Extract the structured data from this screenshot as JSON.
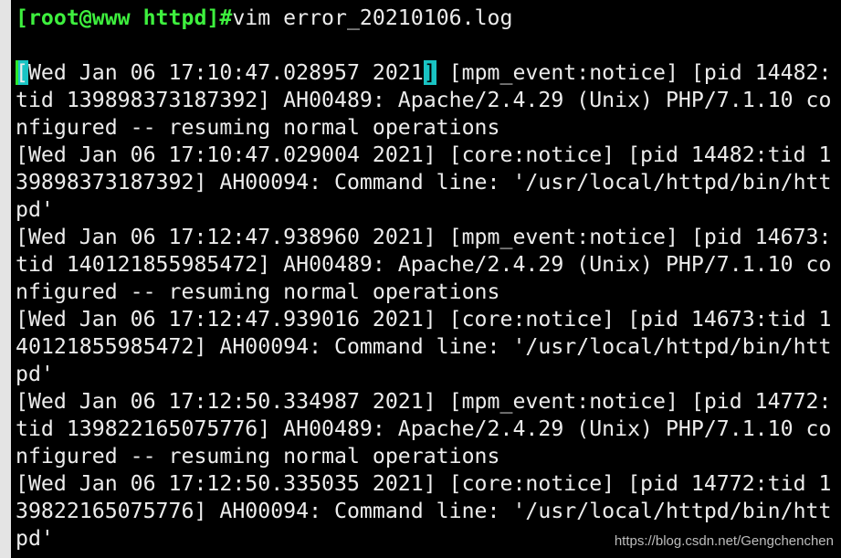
{
  "prompt": "[root@www httpd]#",
  "command": "vim error_20210106.log",
  "cursor_line": {
    "cursor_char": "[",
    "rest": "Wed Jan 06 17:10:47.028957 2021",
    "match_char": "]",
    "tail": " [mpm_event:notice] [pid 14482:"
  },
  "rows": [
    "tid 139898373187392] AH00489: Apache/2.4.29 (Unix) PHP/7.1.10 co",
    "nfigured -- resuming normal operations",
    "[Wed Jan 06 17:10:47.029004 2021] [core:notice] [pid 14482:tid 1",
    "39898373187392] AH00094: Command line: '/usr/local/httpd/bin/htt",
    "pd'",
    "[Wed Jan 06 17:12:47.938960 2021] [mpm_event:notice] [pid 14673:",
    "tid 140121855985472] AH00489: Apache/2.4.29 (Unix) PHP/7.1.10 co",
    "nfigured -- resuming normal operations",
    "[Wed Jan 06 17:12:47.939016 2021] [core:notice] [pid 14673:tid 1",
    "40121855985472] AH00094: Command line: '/usr/local/httpd/bin/htt",
    "pd'",
    "[Wed Jan 06 17:12:50.334987 2021] [mpm_event:notice] [pid 14772:",
    "tid 139822165075776] AH00489: Apache/2.4.29 (Unix) PHP/7.1.10 co",
    "nfigured -- resuming normal operations",
    "[Wed Jan 06 17:12:50.335035 2021] [core:notice] [pid 14772:tid 1",
    "39822165075776] AH00094: Command line: '/usr/local/httpd/bin/htt",
    "pd'"
  ],
  "watermark": "https://blog.csdn.net/Gengchenchen",
  "colors": {
    "prompt": "#3ef03e",
    "text": "#ececec",
    "cursor": "#19c4c4",
    "background": "#000000"
  }
}
